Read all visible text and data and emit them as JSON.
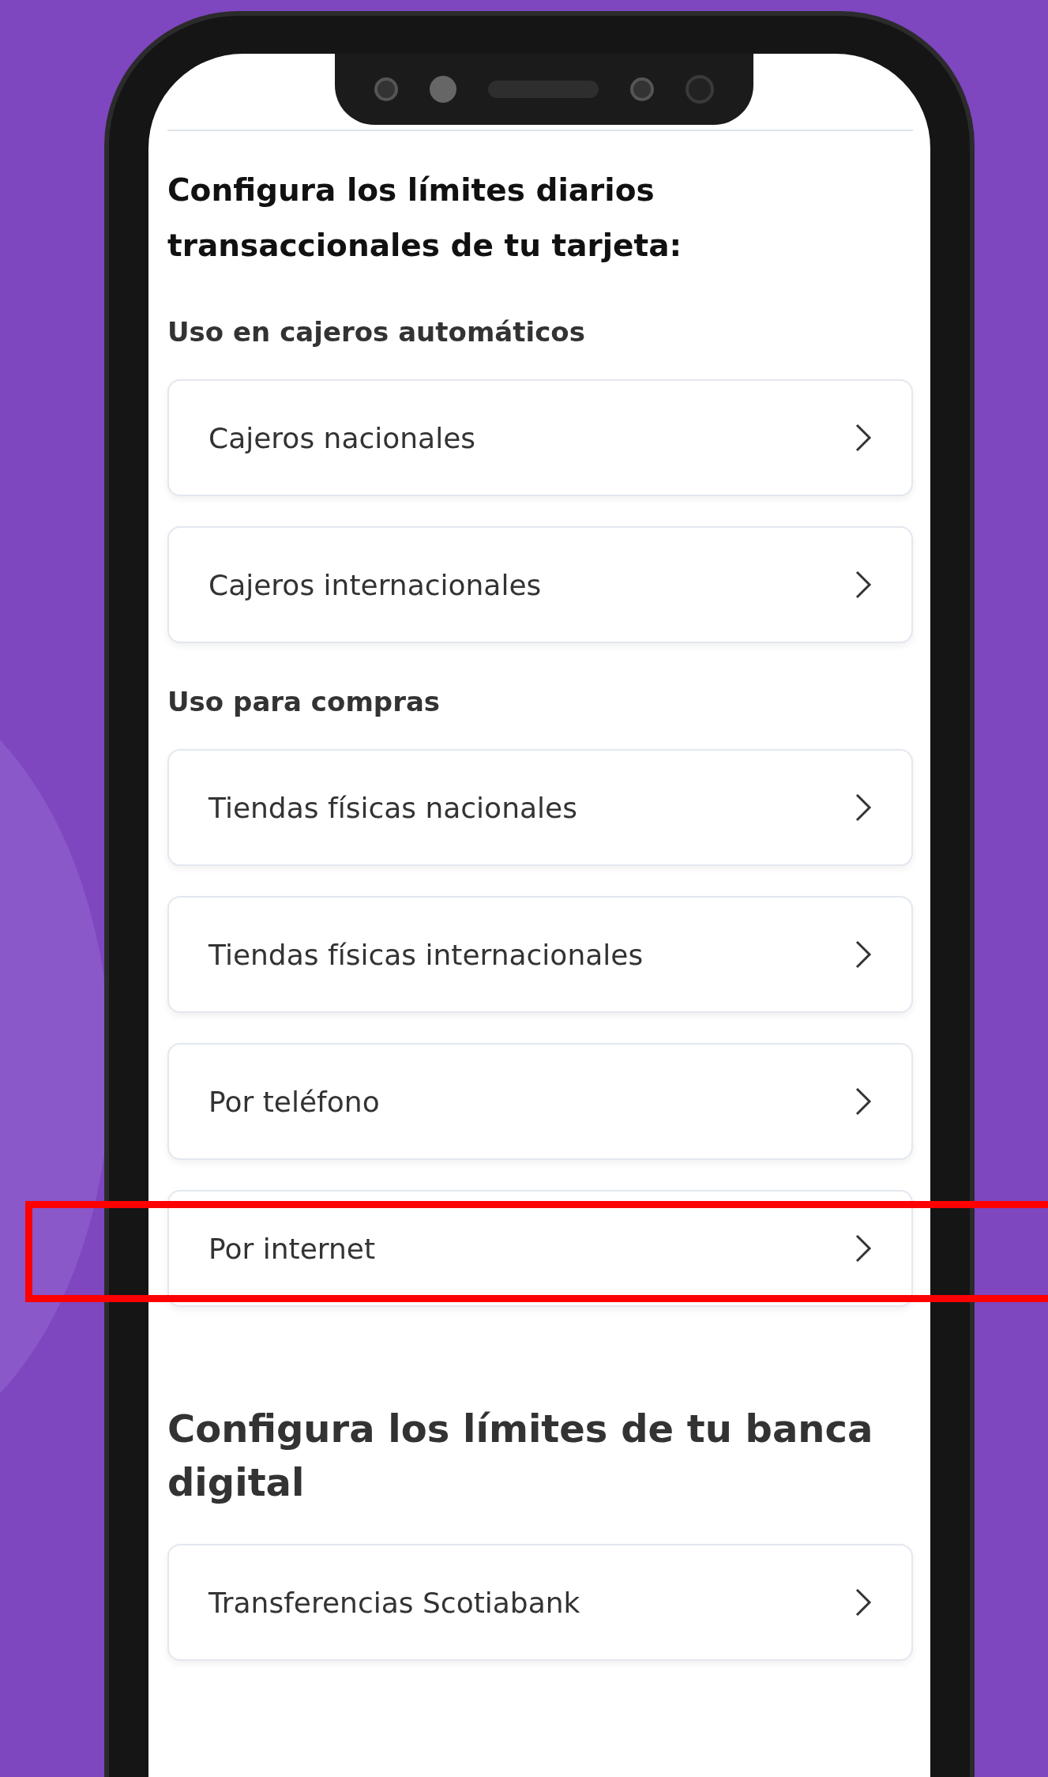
{
  "title": "Configura los límites diarios transaccionales de tu tarjeta:",
  "sections": [
    {
      "heading": "Uso en cajeros automáticos",
      "items": [
        {
          "label": "Cajeros nacionales",
          "highlighted": false
        },
        {
          "label": "Cajeros internacionales",
          "highlighted": false
        }
      ]
    },
    {
      "heading": "Uso para compras",
      "items": [
        {
          "label": "Tiendas físicas nacionales",
          "highlighted": false
        },
        {
          "label": "Tiendas físicas internacionales",
          "highlighted": false
        },
        {
          "label": "Por teléfono",
          "highlighted": false
        },
        {
          "label": "Por internet",
          "highlighted": true
        }
      ]
    }
  ],
  "digital": {
    "heading": "Configura los límites de tu banca digital",
    "items": [
      {
        "label": "Transferencias Scotiabank",
        "highlighted": false
      }
    ]
  }
}
